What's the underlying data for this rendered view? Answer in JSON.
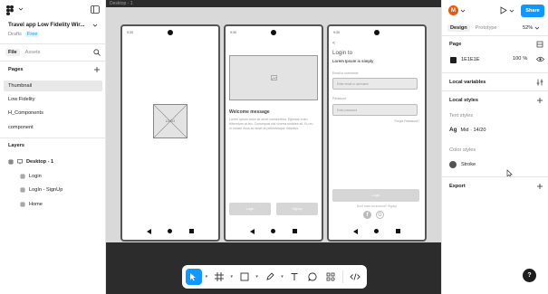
{
  "left_panel": {
    "file_name": "Travel app Low Fidelity Wir...",
    "location": "Drafts",
    "plan_badge": "Free",
    "tabs": [
      "File",
      "Assets"
    ],
    "pages_title": "Pages",
    "pages": [
      "Thumbnail",
      "Low Fidelity",
      "H_Components",
      "component"
    ],
    "layers_title": "Layers",
    "layers": [
      {
        "label": "Desktop - 1"
      },
      {
        "label": "Login"
      },
      {
        "label": "LogIn - SignUp"
      },
      {
        "label": "Home"
      }
    ]
  },
  "canvas": {
    "frame_label": "Desktop - 1",
    "status_time": "9:30",
    "screen1": {
      "logo_text": "LOGO"
    },
    "screen2": {
      "title": "Welcome message",
      "body": "Lorem ipsum dolor sit amet consectetur. Egestas enim bibendum at leo. Consequat nisl viverra sodales sit. Eu eu in ornare risus ac amet at pellentesque ridiculus.",
      "btn_login": "Login",
      "btn_signup": "Signup"
    },
    "screen3": {
      "back": "<",
      "title": "Login to",
      "subtitle": "Lorem Ipsum is simply",
      "email_label": "Email or username",
      "email_placeholder": "Enter email or username",
      "password_label": "Password",
      "password_placeholder": "Enter password",
      "forgot": "Forgot Password?",
      "login_btn": "Login",
      "signup_prompt": "Don't have an account? Signup"
    }
  },
  "right_panel": {
    "avatar_letter": "M",
    "share_label": "Share",
    "tabs": [
      "Design",
      "Prototype"
    ],
    "zoom": "52%",
    "page_title": "Page",
    "page_color_hex": "1E1E1E",
    "page_opacity": "100",
    "page_opacity_unit": "%",
    "local_variables": "Local variables",
    "local_styles": "Local styles",
    "text_styles_title": "Text styles",
    "text_style_sample": "Ag",
    "text_style_name": "Mid · 14/20",
    "color_styles_title": "Color styles",
    "color_style_name": "Stroke",
    "export_label": "Export",
    "help": "?"
  },
  "colors": {
    "accent": "#0d99ff",
    "avatar": "#e8590c",
    "canvas_bg": "#2c2c2c",
    "frame_bg": "#d9d9d9",
    "page_swatch": "#1e1e1e",
    "stroke_swatch": "#555555"
  }
}
